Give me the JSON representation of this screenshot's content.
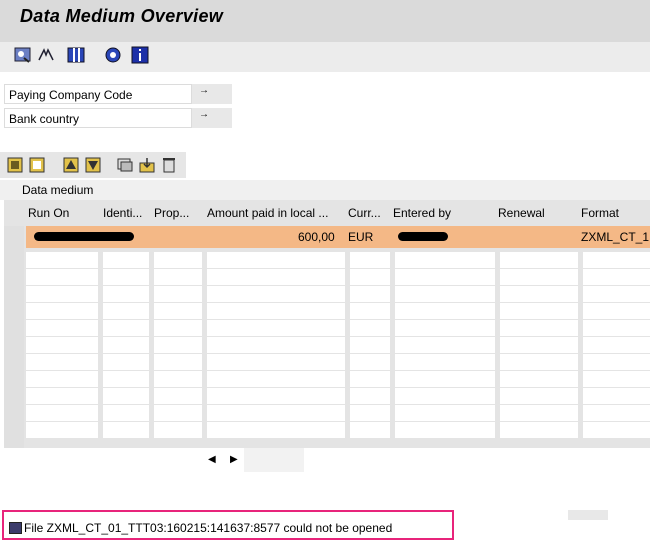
{
  "title": "Data Medium Overview",
  "app_toolbar": {
    "icons": [
      "refresh-icon",
      "filter-icon",
      "columns-icon",
      "settings-icon",
      "info-icon"
    ]
  },
  "selection": {
    "fields": [
      {
        "label": "Paying Company Code",
        "button": "→"
      },
      {
        "label": "Bank country",
        "button": "→"
      }
    ]
  },
  "alv_toolbar": {
    "icons": [
      "select-all-icon",
      "deselect-all-icon",
      "sort-ascending-icon",
      "sort-descending-icon",
      "display-icon",
      "download-icon",
      "delete-icon"
    ]
  },
  "panel": {
    "label": "Data medium"
  },
  "table": {
    "headers": [
      "Run On",
      "Identi...",
      "Prop...",
      "Amount paid in local ...",
      "Curr...",
      "Entered by",
      "Renewal",
      "Format"
    ],
    "row": {
      "amount": "600,00",
      "currency": "EUR",
      "format": "ZXML_CT_1"
    }
  },
  "colors": {
    "highlight_row": "#f4b886",
    "status_border": "#e8247b",
    "title_bar": "#dadada"
  },
  "status": {
    "message": "File ZXML_CT_01_TTT03:160215:141637:8577 could not be opened"
  }
}
